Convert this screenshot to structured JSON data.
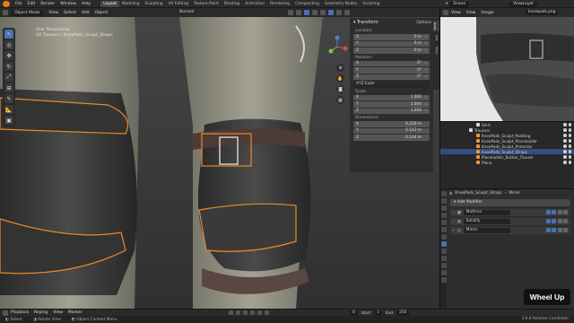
{
  "topbar": {
    "menu": [
      "File",
      "Edit",
      "Render",
      "Window",
      "Help"
    ],
    "workspaces": [
      "Layout",
      "Modeling",
      "Sculpting",
      "UV Editing",
      "Texture Paint",
      "Shading",
      "Animation",
      "Rendering",
      "Compositing",
      "Geometry Nodes",
      "Scripting"
    ],
    "active_workspace": "Layout",
    "scene_label": "Scene",
    "view_layer_label": "ViewLayer"
  },
  "viewport": {
    "mode": "Object Mode",
    "menus": [
      "View",
      "Select",
      "Add",
      "Object"
    ],
    "orientation": "Normal",
    "perspective": "User Perspective",
    "object_info": "(0) Trousers | KneePads_Sculpt_Straps"
  },
  "npanel": {
    "options_label": "Options",
    "section": "Transform",
    "location_label": "Location:",
    "location": [
      {
        "axis": "X",
        "value": "0 m"
      },
      {
        "axis": "Y",
        "value": "0 m"
      },
      {
        "axis": "Z",
        "value": "0 m"
      }
    ],
    "rotation_label": "Rotation:",
    "rotation": [
      {
        "axis": "X",
        "value": "0°"
      },
      {
        "axis": "Y",
        "value": "0°"
      },
      {
        "axis": "Z",
        "value": "0°"
      }
    ],
    "rotation_mode": "XYZ Euler",
    "scale_label": "Scale:",
    "scale": [
      {
        "axis": "X",
        "value": "1.000"
      },
      {
        "axis": "Y",
        "value": "1.000"
      },
      {
        "axis": "Z",
        "value": "1.000"
      }
    ],
    "dimensions_label": "Dimensions:",
    "dimensions": [
      {
        "axis": "X",
        "value": "0.259 m"
      },
      {
        "axis": "Y",
        "value": "0.143 m"
      },
      {
        "axis": "Z",
        "value": "0.144 m"
      }
    ],
    "tabs": [
      "Item",
      "Tool",
      "View"
    ]
  },
  "image_editor": {
    "menus": [
      "View",
      "View",
      "Image"
    ],
    "image_name": "kneepads.png"
  },
  "outliner": {
    "rows": [
      {
        "label": "Shirt",
        "indent": 4,
        "type": "collection",
        "selected": false
      },
      {
        "label": "Trousers",
        "indent": 2,
        "type": "collection",
        "selected": false
      },
      {
        "label": "KneePads_Sculpt_Padding",
        "indent": 4,
        "type": "object",
        "selected": false
      },
      {
        "label": "KneePads_Sculpt_Placeholder",
        "indent": 4,
        "type": "object",
        "selected": false
      },
      {
        "label": "KneePads_Sculpt_Protector",
        "indent": 4,
        "type": "object",
        "selected": false
      },
      {
        "label": "KneePads_Sculpt_Straps",
        "indent": 4,
        "type": "object",
        "selected": true
      },
      {
        "label": "Placeholder_Button_Trouser",
        "indent": 4,
        "type": "object",
        "selected": false
      },
      {
        "label": "Plane",
        "indent": 4,
        "type": "object",
        "selected": false
      }
    ]
  },
  "properties": {
    "object_name": "KneePads_Sculpt_Straps",
    "modifier_context": "Mirror",
    "add_modifier_label": "Add Modifier",
    "modifiers": [
      "Multires",
      "Solidify",
      "Mirror"
    ]
  },
  "timeline": {
    "menus": [
      "Playback",
      "Keying",
      "View",
      "Marker"
    ],
    "current_frame": "0",
    "start_label": "Start",
    "start_value": "1",
    "end_label": "End",
    "end_value": "250"
  },
  "statusbar": {
    "items": [
      "Select",
      "Rotate View",
      "Object Context Menu"
    ],
    "version": "3.6.0 Release Candidate"
  },
  "overlay": {
    "wheel_badge": "Wheel Up"
  },
  "colors": {
    "accent": "#4772b3",
    "selection_outline": "#e8892b",
    "viewport_bg": "#3d3d3d"
  }
}
